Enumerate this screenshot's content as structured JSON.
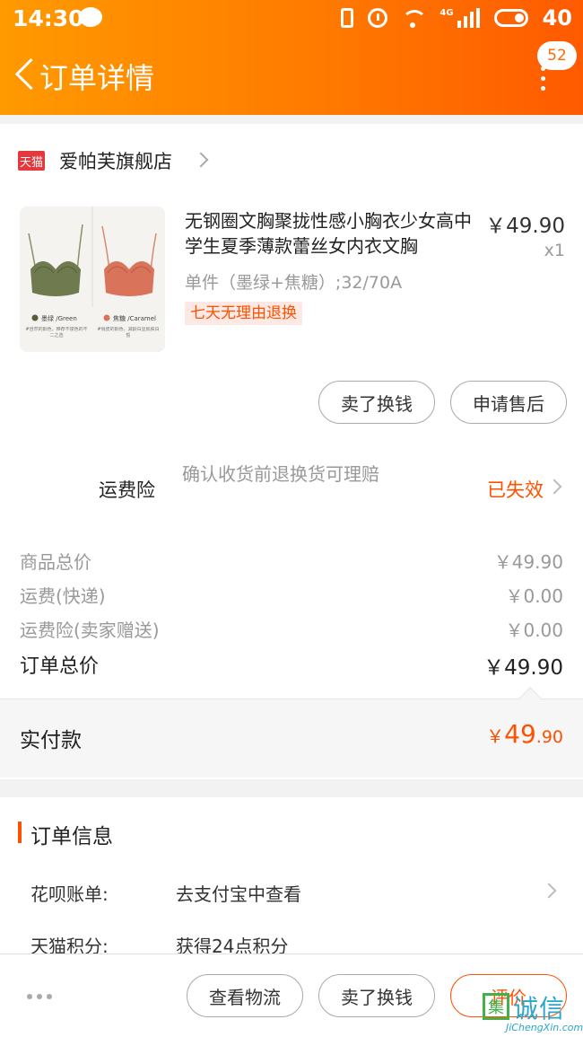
{
  "status_bar": {
    "time": "14:30",
    "network": "4G",
    "battery": "40"
  },
  "header": {
    "title": "订单详情",
    "message_badge": "52"
  },
  "store": {
    "platform_tag": "天猫",
    "name": "爱帕芙旗舰店"
  },
  "product": {
    "title": "无钢圈文胸聚拢性感小胸衣少女高中学生夏季薄款蕾丝女内衣文胸",
    "price": "￥49.90",
    "quantity": "x1",
    "sku": "单件（墨绿+焦糖）;32/70A",
    "return_tag": "七天无理由退换",
    "image_swatches": {
      "green_label": "墨绿 /Green",
      "caramel_label": "焦糖 /Caramel",
      "green_desc": "#自然的颜色，推荐不撞色的不二之选",
      "caramel_desc": "#俏皮的颜色，减龄白显肌肤白皙"
    },
    "actions": [
      "卖了换钱",
      "申请售后"
    ]
  },
  "freight_insurance": {
    "label": "运费险",
    "description": "确认收货前退换货可理赔",
    "status": "已失效"
  },
  "price_summary": {
    "goods_total_label": "商品总价",
    "goods_total": "￥49.90",
    "shipping_label": "运费(快递)",
    "shipping": "￥0.00",
    "insurance_label": "运费险(卖家赠送)",
    "insurance": "￥0.00",
    "order_total_label": "订单总价",
    "order_total": "￥49.90"
  },
  "paid": {
    "label": "实付款",
    "currency": "￥",
    "integer": "49",
    "decimal": ".90"
  },
  "order_info": {
    "title": "订单信息",
    "rows": [
      {
        "label": "花呗账单:",
        "value": "去支付宝中查看"
      },
      {
        "label": "天猫积分:",
        "value": "获得24点积分"
      }
    ]
  },
  "bottom_bar": {
    "buttons": [
      "查看物流",
      "卖了换钱",
      "评价"
    ]
  },
  "watermark": {
    "text": "诚信",
    "box_char": "集",
    "url": "JiChengXin.com"
  },
  "colors": {
    "header_start": "#ff9a00",
    "header_end": "#ff5a00",
    "accent": "#ff5000"
  }
}
